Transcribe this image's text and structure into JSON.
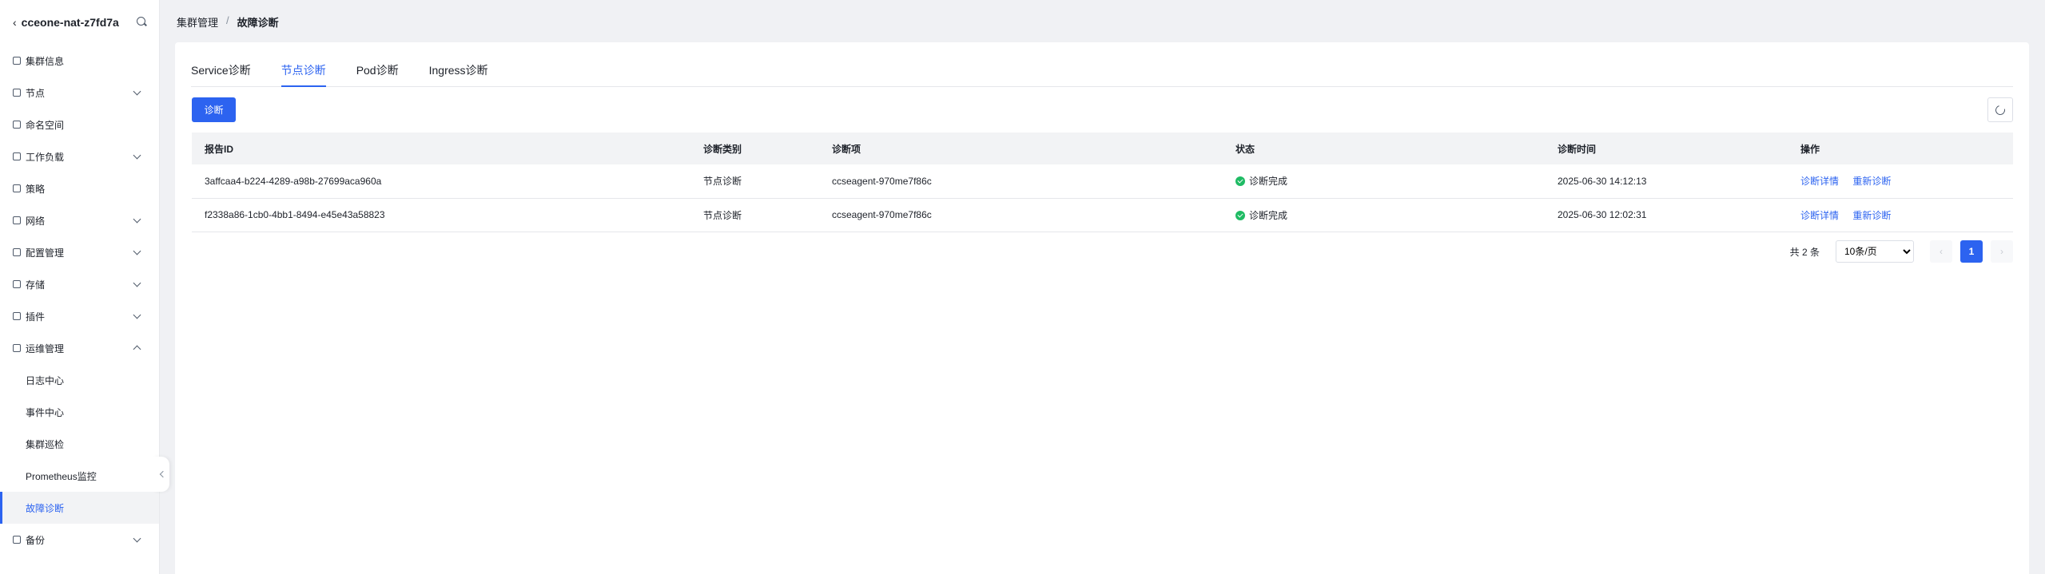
{
  "sidebar": {
    "title": "cceone-nat-z7fd7a",
    "items": [
      {
        "label": "集群信息",
        "icon": "grid-icon",
        "expandable": false
      },
      {
        "label": "节点",
        "icon": "node-icon",
        "expandable": true
      },
      {
        "label": "命名空间",
        "icon": "namespace-icon",
        "expandable": false
      },
      {
        "label": "工作负载",
        "icon": "workload-icon",
        "expandable": true
      },
      {
        "label": "策略",
        "icon": "policy-icon",
        "expandable": false
      },
      {
        "label": "网络",
        "icon": "network-icon",
        "expandable": true
      },
      {
        "label": "配置管理",
        "icon": "config-icon",
        "expandable": true
      },
      {
        "label": "存储",
        "icon": "storage-icon",
        "expandable": true
      },
      {
        "label": "插件",
        "icon": "plugin-icon",
        "expandable": true
      },
      {
        "label": "运维管理",
        "icon": "ops-icon",
        "expandable": true,
        "expanded": true
      }
    ],
    "sub_items": [
      {
        "label": "日志中心"
      },
      {
        "label": "事件中心"
      },
      {
        "label": "集群巡检"
      },
      {
        "label": "Prometheus监控"
      },
      {
        "label": "故障诊断",
        "active": true
      }
    ],
    "after_items": [
      {
        "label": "备份",
        "icon": "backup-icon",
        "expandable": true
      }
    ]
  },
  "breadcrumb": {
    "parent": "集群管理",
    "separator": "/",
    "current": "故障诊断"
  },
  "tabs": [
    {
      "label": "Service诊断",
      "active": false
    },
    {
      "label": "节点诊断",
      "active": true
    },
    {
      "label": "Pod诊断",
      "active": false
    },
    {
      "label": "Ingress诊断",
      "active": false
    }
  ],
  "toolbar": {
    "diagnose_label": "诊断"
  },
  "table": {
    "columns": [
      "报告ID",
      "诊断类别",
      "诊断项",
      "状态",
      "诊断时间",
      "操作"
    ],
    "rows": [
      {
        "id": "3affcaa4-b224-4289-a98b-27699aca960a",
        "category": "节点诊断",
        "item": "ccseagent-970me7f86c",
        "status": "诊断完成",
        "time": "2025-06-30 14:12:13",
        "action_detail": "诊断详情",
        "action_rediagnose": "重新诊断"
      },
      {
        "id": "f2338a86-1cb0-4bb1-8494-e45e43a58823",
        "category": "节点诊断",
        "item": "ccseagent-970me7f86c",
        "status": "诊断完成",
        "time": "2025-06-30 12:02:31",
        "action_detail": "诊断详情",
        "action_rediagnose": "重新诊断"
      }
    ]
  },
  "pagination": {
    "total_text": "共 2 条",
    "page_size": "10条/页",
    "current_page": "1",
    "prev": "‹",
    "next": "›"
  },
  "colors": {
    "accent": "#2c63f0",
    "success": "#1fbb64"
  }
}
